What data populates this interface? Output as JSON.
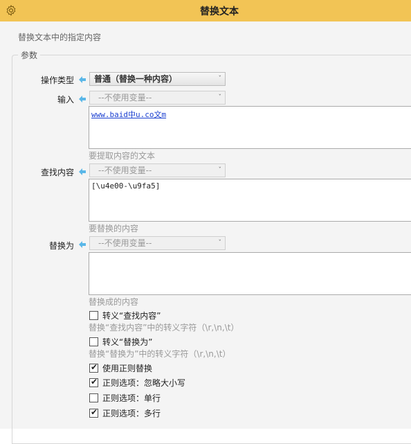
{
  "window": {
    "title": "替换文本"
  },
  "header": {
    "description": "替换文本中的指定内容"
  },
  "params": {
    "legend": "参数",
    "op_type": {
      "label": "操作类型",
      "value": "普通（替换一种内容）"
    },
    "input": {
      "label": "输入",
      "variable": "--不使用变量--",
      "text": "www.baid中u.co文m",
      "hint": "要提取内容的文本"
    },
    "find": {
      "label": "查找内容",
      "variable": "--不使用变量--",
      "text": "[\\u4e00-\\u9fa5]",
      "hint": "要替换的内容"
    },
    "replace": {
      "label": "替换为",
      "variable": "--不使用变量--",
      "text": "",
      "hint": "替换成的内容"
    },
    "options": [
      {
        "label": "转义“查找内容”",
        "checked": false,
        "hint": "替换“查找内容”中的转义字符（\\r,\\n,\\t）"
      },
      {
        "label": "转义“替换为”",
        "checked": false,
        "hint": "替换“替换为”中的转义字符（\\r,\\n,\\t）"
      },
      {
        "label": "使用正则替换",
        "checked": true,
        "hint": ""
      },
      {
        "label": "正则选项：忽略大小写",
        "checked": true,
        "hint": ""
      },
      {
        "label": "正则选项：单行",
        "checked": false,
        "hint": ""
      },
      {
        "label": "正则选项：多行",
        "checked": true,
        "hint": ""
      }
    ]
  },
  "colors": {
    "title_bar": "#f2c455",
    "arrow": "#5ab7e8",
    "link": "#1a3fd0"
  }
}
